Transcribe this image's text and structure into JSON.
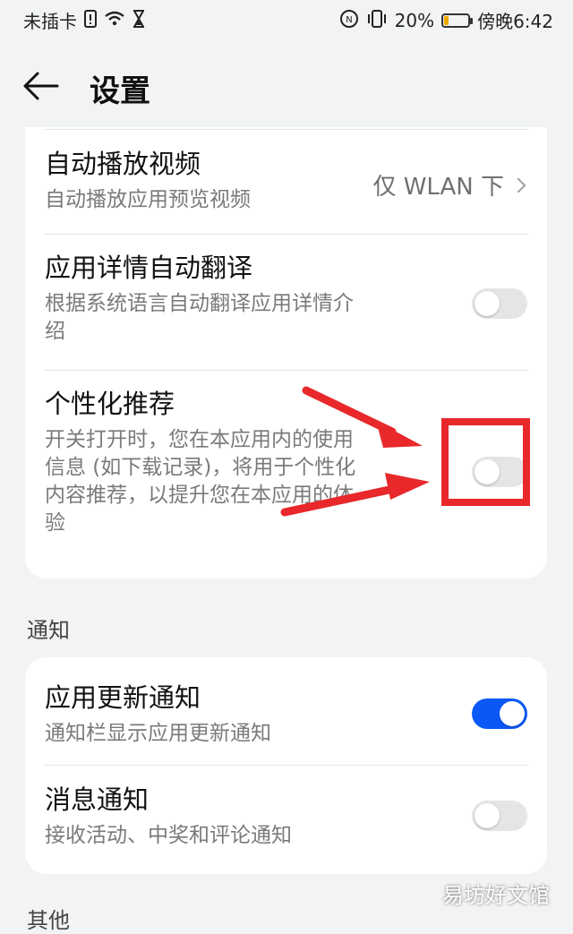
{
  "status_bar": {
    "carrier": "未插卡",
    "battery_percent": "20%",
    "battery_level": 0.2,
    "time": "傍晚6:42",
    "icons": [
      "sim-alert-icon",
      "wifi-icon",
      "hourglass-icon",
      "nfc-icon",
      "vibrate-icon",
      "battery-icon"
    ]
  },
  "header": {
    "title": "设置",
    "back_icon": "back-arrow-icon"
  },
  "settings_card": {
    "items": [
      {
        "title": "自动播放视频",
        "subtitle": "自动播放应用预览视频",
        "value": "仅 WLAN 下"
      },
      {
        "title": "应用详情自动翻译",
        "subtitle_lines": [
          "根据系统语言自动翻译应用详情介",
          "绍"
        ],
        "toggle_on": false
      },
      {
        "title": "个性化推荐",
        "subtitle_lines": [
          "开关打开时，您在本应用内的使用",
          "信息 (如下载记录)，将用于个性化",
          "内容推荐，以提升您在本应用的体",
          "验"
        ],
        "toggle_on": false
      }
    ]
  },
  "notifications": {
    "section_title": "通知",
    "items": [
      {
        "title": "应用更新通知",
        "subtitle": "通知栏显示应用更新通知",
        "toggle_on": true
      },
      {
        "title": "消息通知",
        "subtitle": "接收活动、中奖和评论通知",
        "toggle_on": false
      }
    ]
  },
  "next_section_title": "其他",
  "watermark": "易坊好文馆",
  "annotation_color": "#e8282a",
  "accent_color": "#0a59f7"
}
